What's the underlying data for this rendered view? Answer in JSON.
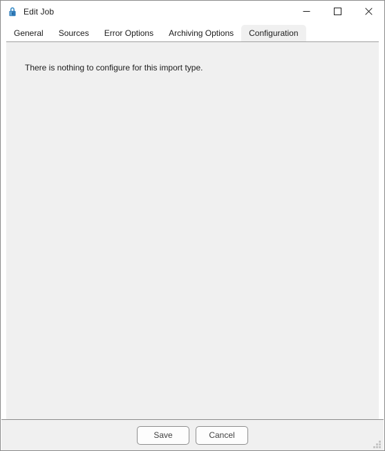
{
  "window": {
    "title": "Edit Job",
    "icon": "padlock-icon",
    "accent_color": "#2f7ab8",
    "background_color": "#f0f0f0",
    "titlebar_color": "#ffffff",
    "border_color": "#8a8a8a",
    "controls": [
      {
        "name": "minimize",
        "glyph": "minimize-icon",
        "label": "Minimize"
      },
      {
        "name": "maximize",
        "glyph": "maximize-icon",
        "label": "Maximize"
      },
      {
        "name": "close",
        "glyph": "close-icon",
        "label": "Close"
      }
    ]
  },
  "tabs": [
    {
      "label": "General",
      "selected": false
    },
    {
      "label": "Sources",
      "selected": false
    },
    {
      "label": "Error Options",
      "selected": false
    },
    {
      "label": "Archiving Options",
      "selected": false
    },
    {
      "label": "Configuration",
      "selected": true
    }
  ],
  "panel": {
    "message": "There is nothing to configure for this import type."
  },
  "footer": {
    "save_label": "Save",
    "cancel_label": "Cancel",
    "resize_grip": "resize-grip"
  }
}
